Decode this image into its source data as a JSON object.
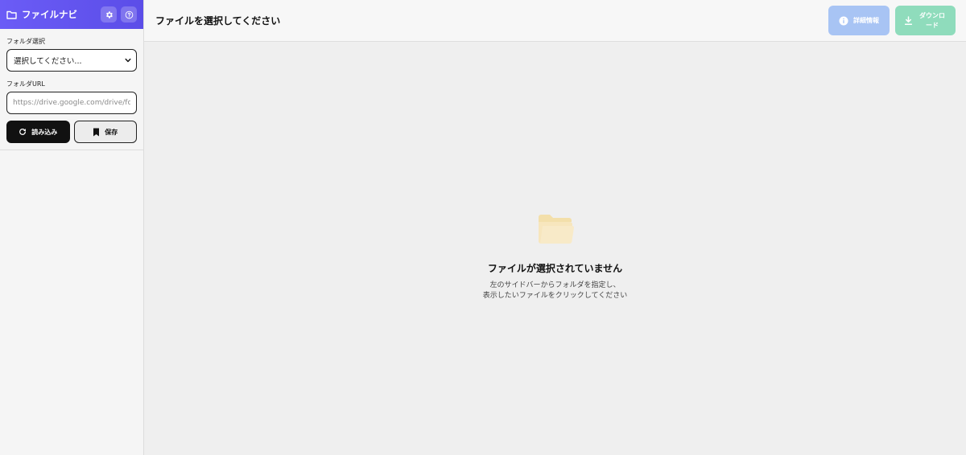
{
  "sidebar": {
    "app_title": "ファイルナビ",
    "folder_select": {
      "label": "フォルダ選択",
      "selected": "選択してください..."
    },
    "folder_url": {
      "label": "フォルダURL",
      "placeholder": "https://drive.google.com/drive/folders/..."
    },
    "load_button": "読み込み",
    "save_button": "保存"
  },
  "header": {
    "title": "ファイルを選択してください",
    "info_button": "詳細情報",
    "download_button": "ダウンロード"
  },
  "empty_state": {
    "title": "ファイルが選択されていません",
    "line1": "左のサイドバーからフォルダを指定し、",
    "line2": "表示したいファイルをクリックしてください"
  },
  "colors": {
    "brand": "#6b5cf6",
    "info_button": "#a8c4f4",
    "download_button": "#8fdcbc",
    "folder_icon": "#f7e6bd"
  },
  "icons": {
    "logo": "folder-outline-icon",
    "settings": "gear-icon",
    "help": "question-circle-icon",
    "load": "refresh-icon",
    "save": "bookmark-icon",
    "info": "info-circle-icon",
    "download": "download-icon",
    "empty": "folder-icon"
  }
}
